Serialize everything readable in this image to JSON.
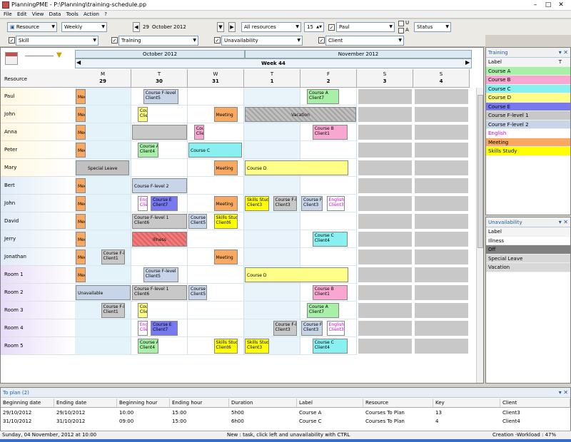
{
  "window": {
    "title": "PlanningPME - P:\\Planning\\training-schedule.pp"
  },
  "menu": [
    "File",
    "Edit",
    "View",
    "Data",
    "Tools",
    "Action",
    "?"
  ],
  "toolbar": {
    "resource_btn": "Resource",
    "view_mode": "Weekly",
    "date_day": "29",
    "date_month": "October",
    "date_year": "2012",
    "resource_filter": "All resources",
    "count": "15",
    "user": "Paul",
    "u_label": "U",
    "a_label": "A",
    "status": "Status",
    "skill": "Skill",
    "training": "Training",
    "unavailability": "Unavailability",
    "client": "Client"
  },
  "calendar": {
    "month1": "October 2012",
    "month2": "November 2012",
    "week": "Week 44",
    "resource_header": "Resource",
    "days": [
      {
        "l": "M",
        "n": "29"
      },
      {
        "l": "T",
        "n": "30"
      },
      {
        "l": "W",
        "n": "31"
      },
      {
        "l": "T",
        "n": "1"
      },
      {
        "l": "F",
        "n": "2"
      },
      {
        "l": "S",
        "n": "3"
      },
      {
        "l": "S",
        "n": "4"
      }
    ],
    "resources": [
      "Paul",
      "John",
      "Anna",
      "Peter",
      "Mary",
      "Bert",
      "John",
      "David",
      "Jerry",
      "Jonathan",
      "Room 1",
      "Room 2",
      "Room 3",
      "Room 4",
      "Room 5"
    ],
    "events": [
      {
        "r": 0,
        "d": 0,
        "o": 0,
        "w": 0.2,
        "t": "Meet",
        "c": "#f8a860"
      },
      {
        "r": 0,
        "d": 1,
        "o": 0.2,
        "w": 0.65,
        "t": "Course F-level 2",
        "t2": "Client5",
        "c": "#c8d4e8"
      },
      {
        "r": 0,
        "d": 4,
        "o": 0.1,
        "w": 0.6,
        "t": "Course A",
        "t2": "Client7",
        "c": "#a8f0a8"
      },
      {
        "r": 1,
        "d": 0,
        "o": 0,
        "w": 0.2,
        "t": "Meet",
        "c": "#f8a860"
      },
      {
        "r": 1,
        "d": 1,
        "o": 0.1,
        "w": 0.2,
        "t": "Cour",
        "t2": "Clien",
        "c": "#ffff88"
      },
      {
        "r": 1,
        "d": 2,
        "o": 0.45,
        "w": 0.45,
        "t": "Meeting",
        "c": "#f8a860"
      },
      {
        "r": 1,
        "d": 3,
        "o": 0,
        "w": 2,
        "t": "Vacation",
        "c": "#c0c0c0",
        "h": 1
      },
      {
        "r": 2,
        "d": 0,
        "o": 0,
        "w": 0.2,
        "t": "Meet",
        "c": "#f8a860"
      },
      {
        "r": 2,
        "d": 1,
        "o": 0,
        "w": 1,
        "t": "",
        "c": "#c8c8c8"
      },
      {
        "r": 2,
        "d": 2,
        "o": 0.1,
        "w": 0.2,
        "t": "Cour",
        "t2": "Clien",
        "c": "#f8a8d0"
      },
      {
        "r": 2,
        "d": 4,
        "o": 0.2,
        "w": 0.65,
        "t": "Course B",
        "t2": "Client1",
        "c": "#f8a8d0"
      },
      {
        "r": 3,
        "d": 0,
        "o": 0,
        "w": 0.2,
        "t": "Meet",
        "c": "#f8a860"
      },
      {
        "r": 3,
        "d": 1,
        "o": 0.1,
        "w": 0.4,
        "t": "Course A",
        "t2": "Client4",
        "c": "#a8f0a8"
      },
      {
        "r": 3,
        "d": 2,
        "o": 0,
        "w": 0.98,
        "t": "Course C",
        "c": "#88f0f0"
      },
      {
        "r": 4,
        "d": 0,
        "o": 0,
        "w": 0.98,
        "t": "Special Leave",
        "c": "#c0c0c0"
      },
      {
        "r": 4,
        "d": 2,
        "o": 0.45,
        "w": 0.45,
        "t": "Meeting",
        "c": "#f8a860"
      },
      {
        "r": 4,
        "d": 3,
        "o": 0,
        "w": 1.86,
        "t": "Course D",
        "c": "#ffff88"
      },
      {
        "r": 5,
        "d": 0,
        "o": 0,
        "w": 0.2,
        "t": "Meet",
        "c": "#f8a860"
      },
      {
        "r": 5,
        "d": 1,
        "o": 0,
        "w": 1,
        "t": "Course F-level 2",
        "c": "#c8d4e8"
      },
      {
        "r": 6,
        "d": 0,
        "o": 0,
        "w": 0.2,
        "t": "Meet",
        "c": "#f8a860"
      },
      {
        "r": 6,
        "d": 1,
        "o": 0.1,
        "w": 0.2,
        "t": "Engl",
        "t2": "Clien",
        "c": "#ffffff",
        "f": "#d000d0"
      },
      {
        "r": 6,
        "d": 1,
        "o": 0.33,
        "w": 0.5,
        "t": "Course E",
        "t2": "Client7",
        "c": "#7878f0"
      },
      {
        "r": 6,
        "d": 2,
        "o": 0.45,
        "w": 0.45,
        "t": "Meeting",
        "c": "#f8a860"
      },
      {
        "r": 6,
        "d": 3,
        "o": 0,
        "w": 0.45,
        "t": "Skills Study",
        "t2": "Client3",
        "c": "#ffff00"
      },
      {
        "r": 6,
        "d": 3,
        "o": 0.5,
        "w": 0.45,
        "t": "Course F-lev",
        "t2": "Client3",
        "c": "#c8c8c8"
      },
      {
        "r": 6,
        "d": 4,
        "o": 0,
        "w": 0.4,
        "t": "Course F-l",
        "t2": "Client3",
        "c": "#c8d4e8"
      },
      {
        "r": 6,
        "d": 4,
        "o": 0.45,
        "w": 0.35,
        "t": "English",
        "t2": "Client3",
        "c": "#ffffff",
        "f": "#d000d0"
      },
      {
        "r": 7,
        "d": 0,
        "o": 0,
        "w": 0.2,
        "t": "Meet",
        "c": "#f8a860"
      },
      {
        "r": 7,
        "d": 1,
        "o": 0,
        "w": 1,
        "t": "Course F-level 1",
        "t2": "Client6",
        "c": "#c8c8c8"
      },
      {
        "r": 7,
        "d": 2,
        "o": 0,
        "w": 0.35,
        "t": "Course F-",
        "t2": "Client5",
        "c": "#c8d4e8"
      },
      {
        "r": 7,
        "d": 2,
        "o": 0.45,
        "w": 0.45,
        "t": "Skills Study",
        "t2": "Client6",
        "c": "#ffff00"
      },
      {
        "r": 8,
        "d": 0,
        "o": 0,
        "w": 0.2,
        "t": "Meet",
        "c": "#f8a860"
      },
      {
        "r": 8,
        "d": 1,
        "o": 0,
        "w": 1,
        "t": "Illness",
        "c": "#f87878",
        "h": 1
      },
      {
        "r": 8,
        "d": 4,
        "o": 0.2,
        "w": 0.65,
        "t": "Course C",
        "t2": "Client4",
        "c": "#88f0f0"
      },
      {
        "r": 9,
        "d": 0,
        "o": 0,
        "w": 0.2,
        "t": "Meet",
        "c": "#f8a860"
      },
      {
        "r": 9,
        "d": 0,
        "o": 0.45,
        "w": 0.45,
        "t": "Course F-le",
        "t2": "Client1",
        "c": "#c8c8c8"
      },
      {
        "r": 9,
        "d": 2,
        "o": 0.45,
        "w": 0.45,
        "t": "Meeting",
        "c": "#f8a860"
      },
      {
        "r": 10,
        "d": 0,
        "o": 0,
        "w": 0.2,
        "t": "Meet",
        "c": "#f8a860"
      },
      {
        "r": 10,
        "d": 1,
        "o": 0.2,
        "w": 0.65,
        "t": "Course F-level 2",
        "t2": "Client5",
        "c": "#c8d4e8"
      },
      {
        "r": 10,
        "d": 3,
        "o": 0,
        "w": 1.86,
        "t": "Course D",
        "c": "#ffff88"
      },
      {
        "r": 11,
        "d": 0,
        "o": 0,
        "w": 1,
        "t": "Unavailable",
        "c": "#c8d4e8"
      },
      {
        "r": 11,
        "d": 1,
        "o": 0,
        "w": 1,
        "t": "Course F-level 1",
        "t2": "Client6",
        "c": "#c8c8c8"
      },
      {
        "r": 11,
        "d": 2,
        "o": 0,
        "w": 0.35,
        "t": "Course F-",
        "t2": "Client5",
        "c": "#c8d4e8"
      },
      {
        "r": 11,
        "d": 4,
        "o": 0.2,
        "w": 0.65,
        "t": "Course B",
        "t2": "Client1",
        "c": "#f8a8d0"
      },
      {
        "r": 12,
        "d": 0,
        "o": 0.45,
        "w": 0.45,
        "t": "Course F-le",
        "t2": "Client1",
        "c": "#c8c8c8"
      },
      {
        "r": 12,
        "d": 1,
        "o": 0.1,
        "w": 0.2,
        "t": "Cour",
        "t2": "Clien",
        "c": "#ffff88"
      },
      {
        "r": 12,
        "d": 4,
        "o": 0.1,
        "w": 0.6,
        "t": "Course A",
        "t2": "Client7",
        "c": "#a8f0a8"
      },
      {
        "r": 13,
        "d": 1,
        "o": 0.1,
        "w": 0.2,
        "t": "Engl",
        "t2": "Clien",
        "c": "#ffffff",
        "f": "#d000d0"
      },
      {
        "r": 13,
        "d": 1,
        "o": 0.33,
        "w": 0.5,
        "t": "Course E",
        "t2": "Client7",
        "c": "#7878f0"
      },
      {
        "r": 13,
        "d": 3,
        "o": 0.5,
        "w": 0.45,
        "t": "Course F-lev",
        "t2": "Client3",
        "c": "#c8c8c8"
      },
      {
        "r": 13,
        "d": 4,
        "o": 0,
        "w": 0.4,
        "t": "Course F-l",
        "t2": "Client3",
        "c": "#c8d4e8"
      },
      {
        "r": 13,
        "d": 4,
        "o": 0.45,
        "w": 0.35,
        "t": "English",
        "t2": "Client3",
        "c": "#ffffff",
        "f": "#d000d0"
      },
      {
        "r": 14,
        "d": 1,
        "o": 0.1,
        "w": 0.4,
        "t": "Course A",
        "t2": "Client4",
        "c": "#a8f0a8"
      },
      {
        "r": 14,
        "d": 2,
        "o": 0.45,
        "w": 0.45,
        "t": "Skills Study",
        "t2": "Client6",
        "c": "#ffff00"
      },
      {
        "r": 14,
        "d": 3,
        "o": 0,
        "w": 0.45,
        "t": "Skills Study",
        "t2": "Client3",
        "c": "#ffff00"
      },
      {
        "r": 14,
        "d": 4,
        "o": 0.2,
        "w": 0.65,
        "t": "Course C",
        "t2": "Client4",
        "c": "#88f0f0"
      }
    ]
  },
  "training_panel": {
    "title": "Training",
    "col1": "Label",
    "col2": "T",
    "items": [
      {
        "label": "Course A",
        "color": "#a8f0a8"
      },
      {
        "label": "Course B",
        "color": "#f8a8d0"
      },
      {
        "label": "Course C",
        "color": "#88f0f0"
      },
      {
        "label": "Course D",
        "color": "#ffff88"
      },
      {
        "label": "Course E",
        "color": "#7878f0"
      },
      {
        "label": "Course F-level 1",
        "color": "#c8c8c8"
      },
      {
        "label": "Course F-level 2",
        "color": "#c8d4e8"
      },
      {
        "label": "English",
        "color": "#ffffff",
        "fg": "#d000d0"
      },
      {
        "label": "Meeting",
        "color": "#f8a860"
      },
      {
        "label": "Skills Study",
        "color": "#ffff00"
      }
    ]
  },
  "unavail_panel": {
    "title": "Unavailability",
    "col": "Label",
    "items": [
      {
        "label": "Illness",
        "color": "#ffffff"
      },
      {
        "label": "Off",
        "color": "#808080"
      },
      {
        "label": "Special Leave",
        "color": "#d8d8d8"
      },
      {
        "label": "Vacation",
        "color": "#d8d8d8"
      }
    ]
  },
  "to_plan": {
    "title": "To plan (2)",
    "headers": [
      "Beginning date",
      "Ending date",
      "Beginning hour",
      "Ending hour",
      "Duration",
      "Label",
      "Resource",
      "Key",
      "Client"
    ],
    "rows": [
      [
        "29/10/2012",
        "29/10/2012",
        "10:00",
        "15:00",
        "5h00",
        "Course A",
        "Courses To Plan",
        "13",
        "Client3"
      ],
      [
        "31/10/2012",
        "31/10/2012",
        "09:00",
        "15:00",
        "6h00",
        "Course C",
        "Courses To Plan",
        "4",
        "Client4"
      ]
    ]
  },
  "status": {
    "left": "Sunday, 04 November, 2012 at 10:00",
    "mid": "New : task, click left and unavailability with CTRL",
    "right": "Creation -Workload : 47%"
  }
}
